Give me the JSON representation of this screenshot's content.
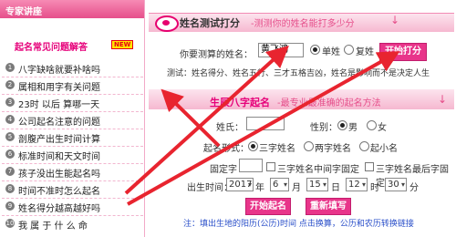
{
  "left": {
    "header": "专家讲座",
    "faq_title": "起名常见问题解答",
    "new_badge": "NEW",
    "items": [
      {
        "num": "1",
        "label": "八字缺啥就要补啥吗"
      },
      {
        "num": "2",
        "label": "属相和用字有关问题"
      },
      {
        "num": "3",
        "label": "23时 以后 算哪一天"
      },
      {
        "num": "4",
        "label": "公司起名注意的问题"
      },
      {
        "num": "5",
        "label": "剖腹产出生时间计算"
      },
      {
        "num": "6",
        "label": "标准时间和天文时间"
      },
      {
        "num": "7",
        "label": "孩子没出生能起名吗"
      },
      {
        "num": "8",
        "label": "时间不准时怎么起名"
      },
      {
        "num": "9",
        "label": "姓名得分越高越好吗"
      },
      {
        "num": "10",
        "label": "我 属 于 什 么 命"
      }
    ]
  },
  "test": {
    "title": "姓名测试打分",
    "subtitle": "-测测你的姓名能打多少分",
    "arrow": "↓",
    "name_label": "你要测算的姓名：",
    "name_value": "黄飞鸿",
    "single_label": "单姓",
    "double_label": "复姓",
    "button": "开始打分",
    "desc": "测试：姓名得分、姓名五行、三才五格吉凶，姓名是影响而不是决定人生"
  },
  "bazi": {
    "title": "生辰八字起名",
    "subtitle": "-最专业最准确的起名方法",
    "arrow": "↓",
    "surname_label": "姓氏：",
    "gender_label": "性别：",
    "male": "男",
    "female": "女",
    "form_label": "起名形式：",
    "form_opts": [
      "三字姓名",
      "两字姓名",
      "起小名"
    ],
    "fixed_label": "固定字",
    "fixed_opts": [
      "三字姓名中间字固定",
      "三字姓名最后字固定"
    ],
    "birth_label": "出生时间：",
    "year": "2017",
    "year_unit": "年",
    "month": "6",
    "month_unit": "月",
    "day": "15",
    "day_unit": "日",
    "hour": "12",
    "hour_unit": "时",
    "minute": "30",
    "minute_unit": "分",
    "start_button": "开始起名",
    "refill_button": "重新填写",
    "note": "注：填出生地的阳历(公历)时间 点击换算，公历和农历转换链接"
  },
  "colors": {
    "accent": "#e8358a",
    "arrow": "#e8242f"
  }
}
